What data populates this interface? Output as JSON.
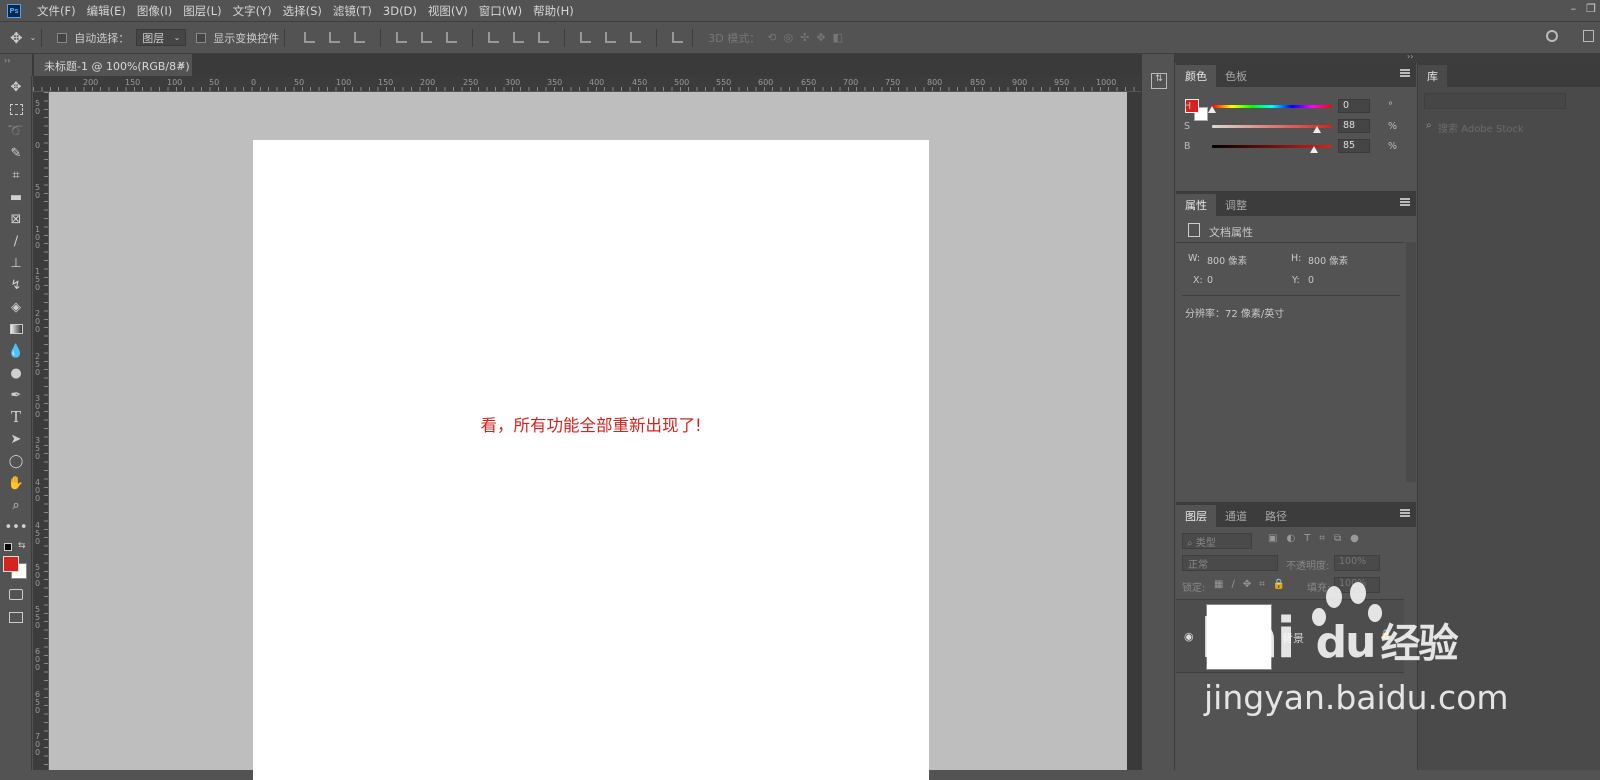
{
  "app": {
    "name": "Ps"
  },
  "menu": [
    "文件(F)",
    "编辑(E)",
    "图像(I)",
    "图层(L)",
    "文字(Y)",
    "选择(S)",
    "滤镜(T)",
    "3D(D)",
    "视图(V)",
    "窗口(W)",
    "帮助(H)"
  ],
  "options": {
    "auto_select_label": "自动选择：",
    "auto_select_value": "图层",
    "show_transform_label": "显示变换控件",
    "mode_3d_label": "3D 模式："
  },
  "document": {
    "tab_title": "未标题-1 @ 100%(RGB/8#)",
    "close_glyph": "×",
    "text": "看，所有功能全部重新出现了!",
    "text_color": "#d7231f"
  },
  "ruler_h": [
    "200",
    "150",
    "100",
    "50",
    "0",
    "50",
    "100",
    "150",
    "200",
    "250",
    "300",
    "350",
    "400",
    "450",
    "500",
    "550",
    "600",
    "650",
    "700",
    "750",
    "800",
    "850",
    "900",
    "950",
    "1000"
  ],
  "ruler_v": [
    "5 0",
    "0",
    "5 0",
    "1 0 0",
    "1 5 0",
    "2 0 0",
    "2 5 0",
    "3 0 0",
    "3 5 0",
    "4 0 0",
    "4 5 0",
    "5 0 0",
    "5 5 0",
    "6 0 0",
    "6 5 0",
    "7 0 0"
  ],
  "tools": [
    "move",
    "marquee",
    "lasso",
    "quick-select",
    "crop",
    "eyedropper",
    "frame",
    "brush",
    "stamp",
    "history-brush",
    "eraser",
    "gradient",
    "blur",
    "dodge",
    "pen",
    "type",
    "path-select",
    "ellipse",
    "hand",
    "zoom",
    "more"
  ],
  "color_panel": {
    "tabs": [
      "颜色",
      "色板"
    ],
    "foreground": "#d7231f",
    "h": {
      "label": "H",
      "value": "0",
      "unit": "°"
    },
    "s": {
      "label": "S",
      "value": "88",
      "unit": "%"
    },
    "b": {
      "label": "B",
      "value": "85",
      "unit": "%"
    }
  },
  "properties_panel": {
    "tabs": [
      "属性",
      "调整"
    ],
    "title": "文档属性",
    "w_label": "W:",
    "w_value": "800 像素",
    "h_label": "H:",
    "h_value": "800 像素",
    "x_label": "X:",
    "x_value": "0",
    "y_label": "Y:",
    "y_value": "0",
    "resolution": "分辨率：72 像素/英寸"
  },
  "layers_panel": {
    "tabs": [
      "图层",
      "通道",
      "路径"
    ],
    "filter_placeholder": "类型",
    "blend_mode": "正常",
    "opacity_label": "不透明度:",
    "opacity_value": "100%",
    "lock_label": "锁定:",
    "fill_label": "填充:",
    "fill_value": "100%",
    "layer_name": "背景"
  },
  "library_panel": {
    "tab": "库",
    "search_placeholder": "搜索 Adobe Stock"
  },
  "watermark": {
    "brand": "Bai",
    "brand2": "du",
    "brand_cn": "经验",
    "url": "jingyan.baidu.com"
  }
}
